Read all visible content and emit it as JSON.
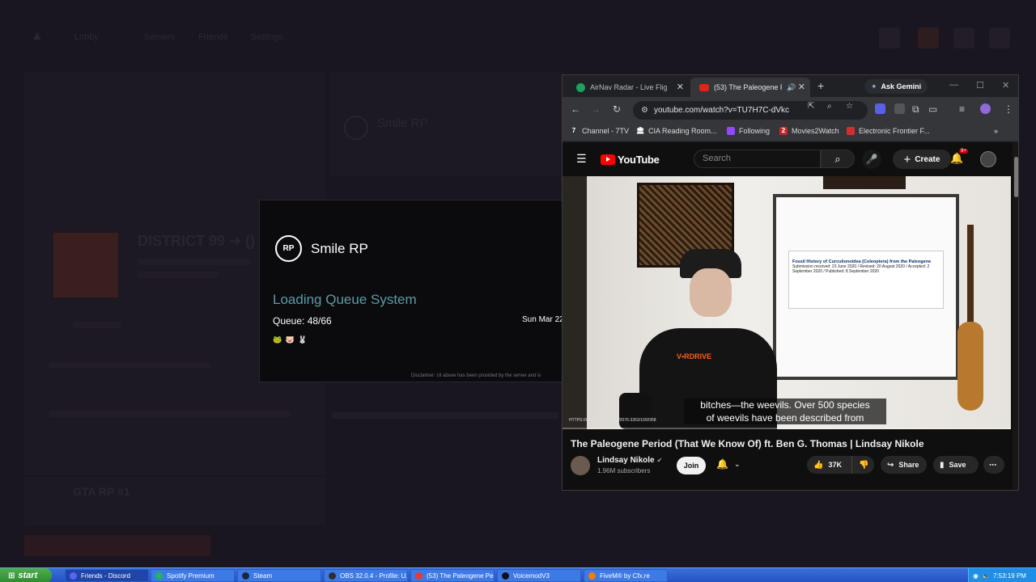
{
  "background": {
    "nav_items": [
      "Lobby",
      "Servers",
      "Friends",
      "Settings"
    ],
    "server_title": "Smile RP",
    "district_text": "DISTRICT 99 ➔ ()",
    "playlist_text": "GTA RP #1"
  },
  "popup": {
    "logo_text": "RP",
    "server_name": "Smile RP",
    "loading_text": "Loading Queue System",
    "queue_text": "Queue: 48/66",
    "emojis": "🐸 🐷 🐰",
    "date_text": "Sun Mar 22",
    "disclaimer": "Disclaimer: UI above has been provided by the server and is"
  },
  "browser": {
    "tabs": [
      {
        "title": "AirNav Radar - Live Flight",
        "icon": "airnav-icon"
      },
      {
        "title": "(53) The Paleogene Pe",
        "icon": "youtube-icon",
        "audio": "🔊"
      }
    ],
    "new_tab": "+",
    "gemini_label": "Ask Gemini",
    "url": "youtube.com/watch?v=TU7H7C-dVkc",
    "bookmarks": [
      {
        "label": "Channel - 7TV",
        "icon": "7",
        "color": "#202124"
      },
      {
        "label": "CIA Reading Room...",
        "icon": "🏛",
        "color": "#202124"
      },
      {
        "label": "Following",
        "icon": "◆",
        "color": "#9146ff"
      },
      {
        "label": "Movies2Watch",
        "icon": "2",
        "color": "#c62828"
      },
      {
        "label": "Electronic Frontier F...",
        "icon": "",
        "color": "#d32f2f"
      }
    ],
    "more_bookmarks": "»"
  },
  "youtube": {
    "logo_text": "YouTube",
    "search_placeholder": "Search",
    "create_label": "Create",
    "notification_count": "9+",
    "caption_line1": "bitches—the weevils. Over 500 species",
    "caption_line2": "of weevils have been described from",
    "paper_title": "Fossil History of Curculionoidea (Coleoptera) from the Paleogene",
    "paper_meta": "Submission received: 23 June 2020 / Revised: 20 August 2020 / Accepted: 2 September 2020 / Published: 8 September 2020",
    "shirt_text": "V•RDRIVE",
    "video_url_overlay": "HTTPS://WWW.MDPI.COM/2076-3263/10/9/358",
    "progress": 0.0,
    "video_title": "The Paleogene Period (That We Know Of) ft. Ben G. Thomas | Lindsay Nikole",
    "channel_name": "Lindsay Nikole",
    "verified_glyph": "✔",
    "subscribers": "1.96M subscribers",
    "join_label": "Join",
    "likes": "37K",
    "share_label": "Share",
    "save_label": "Save"
  },
  "taskbar": {
    "start_label": "start",
    "items": [
      {
        "label": "Friends - Discord",
        "color": "#5865f2",
        "active": true
      },
      {
        "label": "Spotify Premium",
        "color": "#1db954",
        "active": false
      },
      {
        "label": "Steam",
        "color": "#1b2838",
        "active": false
      },
      {
        "label": "OBS 32.0.4 - Profile: U...",
        "color": "#302e31",
        "active": false
      },
      {
        "label": "(53) The Paleogene Pe...",
        "color": "#e53935",
        "active": false
      },
      {
        "label": "VoicemodV3",
        "color": "#111111",
        "active": false
      },
      {
        "label": "FiveM® by Cfx.re",
        "color": "#f57c00",
        "active": false
      }
    ],
    "clock": "7:53:19 PM"
  }
}
